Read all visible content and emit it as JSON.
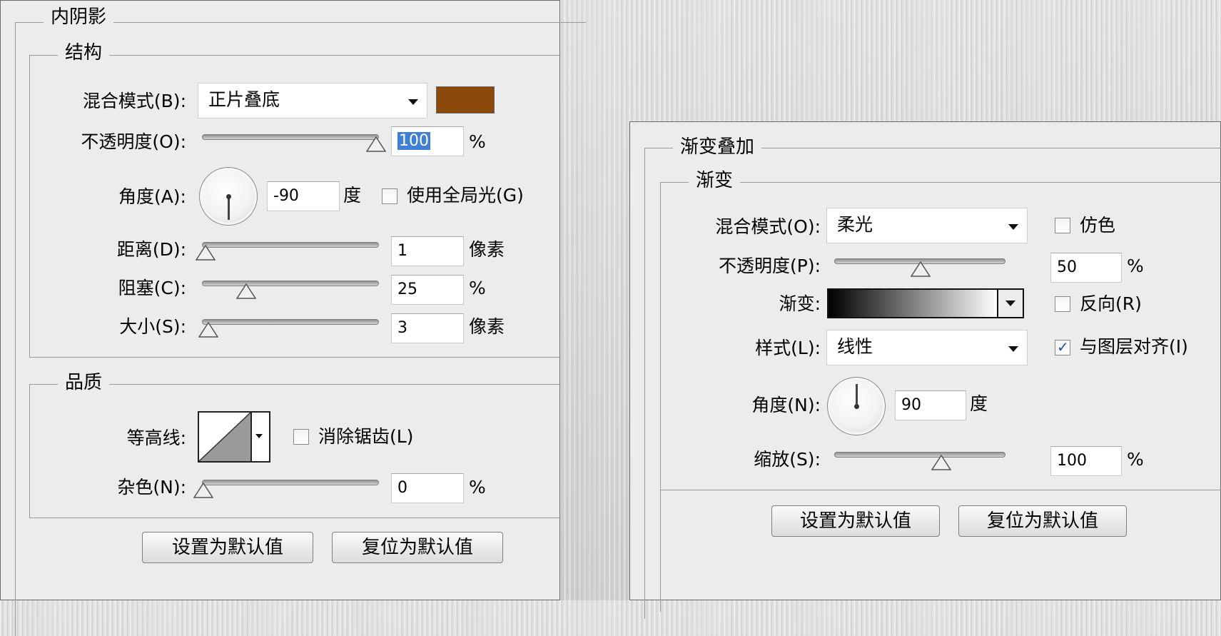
{
  "left_panel": {
    "title": "内阴影",
    "structure": {
      "title": "结构",
      "blend_mode": {
        "label": "混合模式(B):",
        "value": "正片叠底",
        "color": "#8b4a0c"
      },
      "opacity": {
        "label": "不透明度(O):",
        "value": "100",
        "unit": "%",
        "slider": 1.0
      },
      "angle": {
        "label": "角度(A):",
        "value": "-90",
        "unit": "度",
        "global_light_label": "使用全局光(G)",
        "global_light_checked": false
      },
      "distance": {
        "label": "距离(D):",
        "value": "1",
        "unit": "像素",
        "slider": 0.02
      },
      "choke": {
        "label": "阻塞(C):",
        "value": "25",
        "unit": "%",
        "slider": 0.25
      },
      "size": {
        "label": "大小(S):",
        "value": "3",
        "unit": "像素",
        "slider": 0.03
      }
    },
    "quality": {
      "title": "品质",
      "contour": {
        "label": "等高线:",
        "antialias_label": "消除锯齿(L)",
        "antialias_checked": false
      },
      "noise": {
        "label": "杂色(N):",
        "value": "0",
        "unit": "%",
        "slider": 0.0
      }
    },
    "buttons": {
      "set_default": "设置为默认值",
      "reset_default": "复位为默认值"
    }
  },
  "right_panel": {
    "title": "渐变叠加",
    "gradient_group": {
      "title": "渐变",
      "blend_mode": {
        "label": "混合模式(O):",
        "value": "柔光",
        "dither_label": "仿色",
        "dither_checked": false
      },
      "opacity": {
        "label": "不透明度(P):",
        "value": "50",
        "unit": "%",
        "slider": 0.5
      },
      "gradient": {
        "label": "渐变:",
        "reverse_label": "反向(R)",
        "reverse_checked": false
      },
      "style": {
        "label": "样式(L):",
        "value": "线性",
        "align_label": "与图层对齐(I)",
        "align_checked": true
      },
      "angle": {
        "label": "角度(N):",
        "value": "90",
        "unit": "度"
      },
      "scale": {
        "label": "缩放(S):",
        "value": "100",
        "unit": "%",
        "slider": 0.6
      }
    },
    "buttons": {
      "set_default": "设置为默认值",
      "reset_default": "复位为默认值"
    }
  }
}
